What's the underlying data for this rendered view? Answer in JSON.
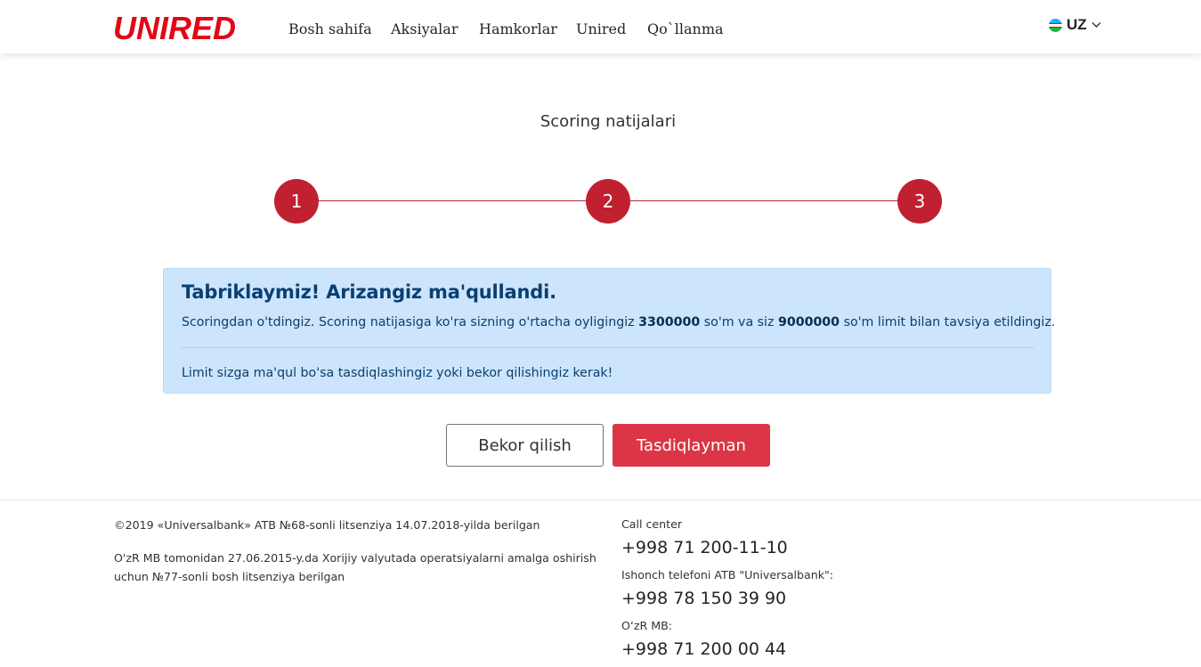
{
  "header": {
    "logo": "UNIRED",
    "nav": [
      "Bosh sahifa",
      "Aksiyalar",
      "Hamkorlar",
      "Unired",
      "Qo`llanma"
    ],
    "language": "UZ"
  },
  "main": {
    "title": "Scoring natijalari",
    "steps": [
      "1",
      "2",
      "3"
    ],
    "alert": {
      "heading": "Tabriklaymiz! Arizangiz ma'qullandi.",
      "text_before_salary": "Scoringdan o'tdingiz. Scoring natijasiga ko'ra sizning o'rtacha oyligingiz",
      "salary": "3300000",
      "text_between": "so'm va siz",
      "limit": "9000000",
      "text_after_limit": "so'm limit bilan tavsiya etildingiz.",
      "note": "Limit sizga ma'qul bo'sa tasdiqlashingiz yoki bekor qilishingiz kerak!"
    },
    "buttons": {
      "cancel": "Bekor qilish",
      "confirm": "Tasdiqlayman"
    }
  },
  "footer": {
    "license_1": "©2019 «Universalbank» ATB №68-sonli litsenziya 14.07.2018-yilda berilgan",
    "license_2_line1": "O'zR MB tomonidan 27.06.2015-y.da Xorijiy valyutada operatsiyalarni amalga oshirish",
    "license_2_line2": "uchun №77-sonli bosh litsenziya berilgan",
    "contacts": [
      {
        "label": "Call center",
        "phone": "+998 71 200-11-10"
      },
      {
        "label": "Ishonch telefoni ATB \"Universalbank\":",
        "phone": "+998 78 150 39 90"
      },
      {
        "label": "O‘zR MB:",
        "phone": "+998 71 200 00 44"
      }
    ]
  },
  "colors": {
    "brand_red": "#e30613",
    "step_red": "#c0202f",
    "confirm_button": "#dc3545",
    "alert_bg": "#cce5fc",
    "alert_heading": "#0b3f72"
  },
  "icons": {
    "language_flag": "uzbekistan-flag-icon",
    "language_dropdown": "chevron-down-icon"
  }
}
